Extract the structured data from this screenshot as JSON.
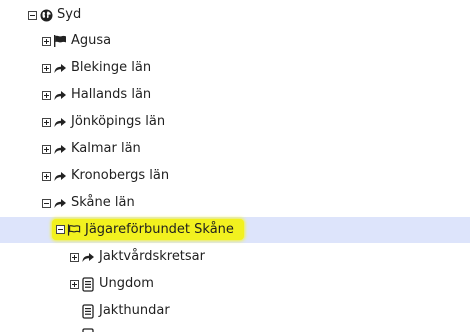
{
  "tree": {
    "nodes": [
      {
        "label": "Syd",
        "icon": "globe-icon",
        "toggle": "minus"
      },
      {
        "label": "Agusa",
        "icon": "flag-icon",
        "toggle": "plus"
      },
      {
        "label": "Blekinge län",
        "icon": "share-arrow-icon",
        "toggle": "plus"
      },
      {
        "label": "Hallands län",
        "icon": "share-arrow-icon",
        "toggle": "plus"
      },
      {
        "label": "Jönköpings län",
        "icon": "share-arrow-icon",
        "toggle": "plus"
      },
      {
        "label": "Kalmar län",
        "icon": "share-arrow-icon",
        "toggle": "plus"
      },
      {
        "label": "Kronobergs län",
        "icon": "share-arrow-icon",
        "toggle": "plus"
      },
      {
        "label": "Skåne län",
        "icon": "share-arrow-icon",
        "toggle": "minus"
      },
      {
        "label": "Jägareförbundet Skåne",
        "icon": "flag-outline-icon",
        "toggle": "minus",
        "selected": true
      },
      {
        "label": "Jaktvårdskretsar",
        "icon": "share-arrow-icon",
        "toggle": "plus"
      },
      {
        "label": "Ungdom",
        "icon": "document-icon",
        "toggle": "plus"
      },
      {
        "label": "Jakthundar",
        "icon": "document-icon",
        "toggle": "none"
      }
    ]
  },
  "colors": {
    "selection_background": "#dde4fb",
    "highlight": "#f2f11f"
  }
}
